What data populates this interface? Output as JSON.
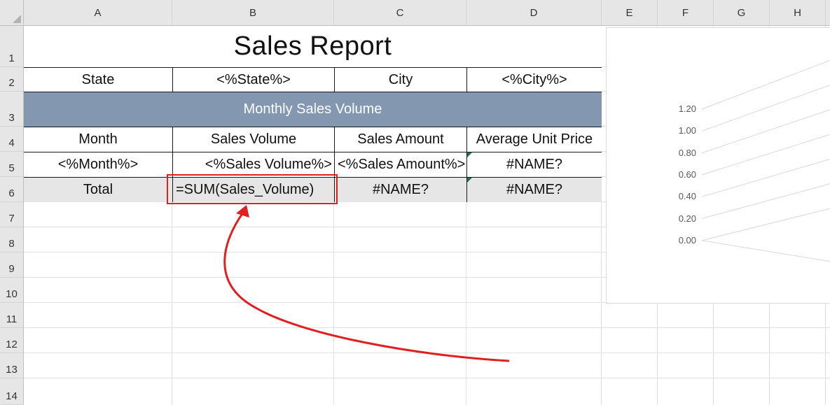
{
  "columns": [
    "A",
    "B",
    "C",
    "D",
    "E",
    "F",
    "G",
    "H"
  ],
  "rows": [
    "1",
    "2",
    "3",
    "4",
    "5",
    "6",
    "7",
    "8",
    "9",
    "10",
    "11",
    "12",
    "13",
    "14"
  ],
  "report": {
    "title": "Sales Report",
    "row2": [
      "State",
      "<%State%>",
      "City",
      "<%City%>"
    ],
    "banner": "Monthly Sales Volume",
    "headers": [
      "Month",
      "Sales Volume",
      "Sales Amount",
      "Average Unit Price"
    ],
    "data_row": [
      "<%Month%>",
      "<%Sales Volume%>",
      "<%Sales Amount%>",
      "#NAME?"
    ],
    "total_row": [
      "Total",
      "=SUM(Sales_Volume)",
      "#NAME?",
      "#NAME?"
    ]
  },
  "chart_data": {
    "type": "line",
    "yticks": [
      "1.20",
      "1.00",
      "0.80",
      "0.60",
      "0.40",
      "0.20",
      "0.00"
    ],
    "ylim": [
      0,
      1.2
    ],
    "series": []
  },
  "colors": {
    "banner_bg": "#8497b0",
    "total_bg": "#e7e6e6",
    "highlight": "#e02020",
    "error_indicator": "#217346"
  }
}
